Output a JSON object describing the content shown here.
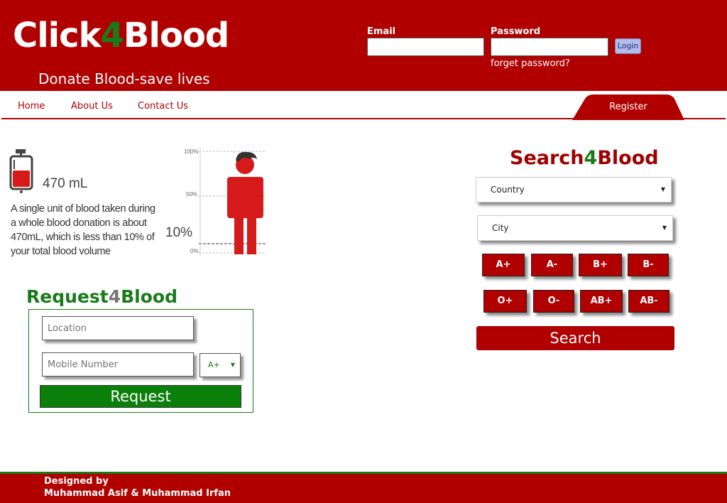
{
  "header": {
    "logo_part1": "Click",
    "logo_part2": "4",
    "logo_part3": "Blood",
    "tagline": "Donate Blood-save lives",
    "email_label": "Email",
    "password_label": "Password",
    "email_value": "",
    "password_value": "",
    "login_label": "Login",
    "forget_label": "forget password?"
  },
  "nav": {
    "items": [
      "Home",
      "About Us",
      "Contact Us"
    ],
    "register_label": "Register"
  },
  "infographic": {
    "volume": "470 mL",
    "text": "A single unit of blood taken during a whole blood donation is about 470mL, which is less than 10% of your total blood volume",
    "pct_100": "100%",
    "pct_50": "50%",
    "pct_10": "10%",
    "pct_0": "0%",
    "icons": [
      "blood-bag-icon",
      "person-figure-icon"
    ]
  },
  "request": {
    "title_part1": "Request",
    "title_part2": "4",
    "title_part3": "Blood",
    "location_placeholder": "Location",
    "mobile_placeholder": "Mobile Number",
    "blood_group_selected": "A+",
    "button_label": "Request"
  },
  "search": {
    "title_part1": "Search",
    "title_part2": "4",
    "title_part3": "Blood",
    "country_selected": "Country",
    "city_selected": "City",
    "blood_groups": [
      "A+",
      "A-",
      "B+",
      "B-",
      "O+",
      "O-",
      "AB+",
      "AB-"
    ],
    "button_label": "Search"
  },
  "footer": {
    "line1": "Designed by",
    "line2": "Muhammad Asif & Muhammad Irfan"
  },
  "colors": {
    "brand_red": "#b00000",
    "brand_green": "#1a7a1a",
    "request_green": "#0a7f0a"
  }
}
